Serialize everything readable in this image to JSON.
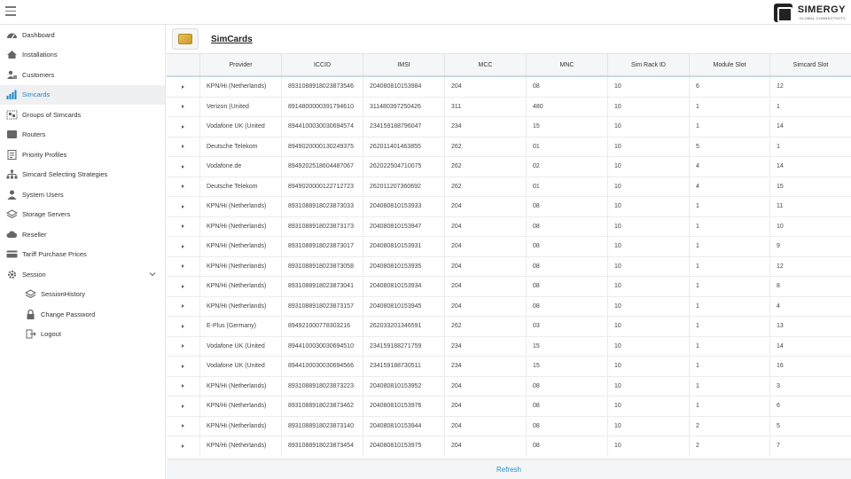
{
  "brand": {
    "title": "SIMERGY",
    "subtitle": "GLOBAL CONNECTIVITY"
  },
  "sidebar": {
    "items": [
      {
        "label": "Dashboard",
        "icon": "dashboard-icon"
      },
      {
        "label": "Installations",
        "icon": "home-icon"
      },
      {
        "label": "Customers",
        "icon": "customers-icon"
      },
      {
        "label": "Simcards",
        "icon": "signal-bars-icon",
        "active": true
      },
      {
        "label": "Groups of Simcards",
        "icon": "groups-icon"
      },
      {
        "label": "Routers",
        "icon": "router-icon"
      },
      {
        "label": "Priority Profiles",
        "icon": "priority-icon"
      },
      {
        "label": "Simcard Selecting Strategies",
        "icon": "strategy-icon"
      },
      {
        "label": "System Users",
        "icon": "user-icon"
      },
      {
        "label": "Storage Servers",
        "icon": "layers-icon"
      },
      {
        "label": "Reseller",
        "icon": "cloud-icon"
      },
      {
        "label": "Tariff Purchase Prices",
        "icon": "tariff-icon"
      },
      {
        "label": "Session",
        "icon": "gear-icon"
      }
    ],
    "session_items": [
      {
        "label": "SessionHistory",
        "icon": "layers-icon"
      },
      {
        "label": "Change Password",
        "icon": "lock-icon"
      },
      {
        "label": "Logout",
        "icon": "logout-icon"
      }
    ]
  },
  "page": {
    "title": "SimCards"
  },
  "table": {
    "headers": [
      "Provider",
      "ICCID",
      "IMSI",
      "MCC",
      "MNC",
      "Sim Rack ID",
      "Module Slot",
      "Simcard Slot"
    ],
    "rows": [
      [
        "KPN/Hi (Netherlands)",
        "8931088918023873546",
        "204080810153984",
        "204",
        "08",
        "10",
        "6",
        "12"
      ],
      [
        "Verizon (United",
        "8914800000391794610",
        "311480397250426",
        "311",
        "480",
        "10",
        "1",
        "1"
      ],
      [
        "Vodafone UK (United",
        "8944100030030694574",
        "234159188796047",
        "234",
        "15",
        "10",
        "1",
        "14"
      ],
      [
        "Deutsche Telekom",
        "8949020000130249375",
        "262011401463855",
        "262",
        "01",
        "10",
        "5",
        "1"
      ],
      [
        "Vodafone.de",
        "8949202518604487067",
        "262022504710075",
        "262",
        "02",
        "10",
        "4",
        "14"
      ],
      [
        "Deutsche Telekom",
        "8949020000122712723",
        "262011207360692",
        "262",
        "01",
        "10",
        "4",
        "15"
      ],
      [
        "KPN/Hi (Netherlands)",
        "8931088918023873033",
        "204080810153933",
        "204",
        "08",
        "10",
        "1",
        "11"
      ],
      [
        "KPN/Hi (Netherlands)",
        "8931088918023873173",
        "204080810153947",
        "204",
        "08",
        "10",
        "1",
        "10"
      ],
      [
        "KPN/Hi (Netherlands)",
        "8931088918023873017",
        "204080810153931",
        "204",
        "08",
        "10",
        "1",
        "9"
      ],
      [
        "KPN/Hi (Netherlands)",
        "8931088918023873058",
        "204080810153935",
        "204",
        "08",
        "10",
        "1",
        "12"
      ],
      [
        "KPN/Hi (Netherlands)",
        "8931088918023873041",
        "204080810153934",
        "204",
        "08",
        "10",
        "1",
        "8"
      ],
      [
        "KPN/Hi (Netherlands)",
        "8931088918023873157",
        "204080810153945",
        "204",
        "08",
        "10",
        "1",
        "4"
      ],
      [
        "E-Plus (Germany)",
        "894921000778303216",
        "262033201346591",
        "262",
        "03",
        "10",
        "1",
        "13"
      ],
      [
        "Vodafone UK (United",
        "8944100030030694510",
        "234159188271759",
        "234",
        "15",
        "10",
        "1",
        "14"
      ],
      [
        "Vodafone UK (United",
        "8944100030030694566",
        "234159188730511",
        "234",
        "15",
        "10",
        "1",
        "16"
      ],
      [
        "KPN/Hi (Netherlands)",
        "8931088918023873223",
        "204080810153952",
        "204",
        "08",
        "10",
        "1",
        "3"
      ],
      [
        "KPN/Hi (Netherlands)",
        "8931088918023873462",
        "204080810153976",
        "204",
        "08",
        "10",
        "1",
        "6"
      ],
      [
        "KPN/Hi (Netherlands)",
        "8931088918023873140",
        "204080810153944",
        "204",
        "08",
        "10",
        "2",
        "5"
      ],
      [
        "KPN/Hi (Netherlands)",
        "8931088918023873454",
        "204080810153975",
        "204",
        "08",
        "10",
        "2",
        "7"
      ]
    ]
  },
  "footer": {
    "refresh_label": "Refresh"
  },
  "colors": {
    "accent": "#1e88c8",
    "active_bg": "#eef0f2"
  }
}
